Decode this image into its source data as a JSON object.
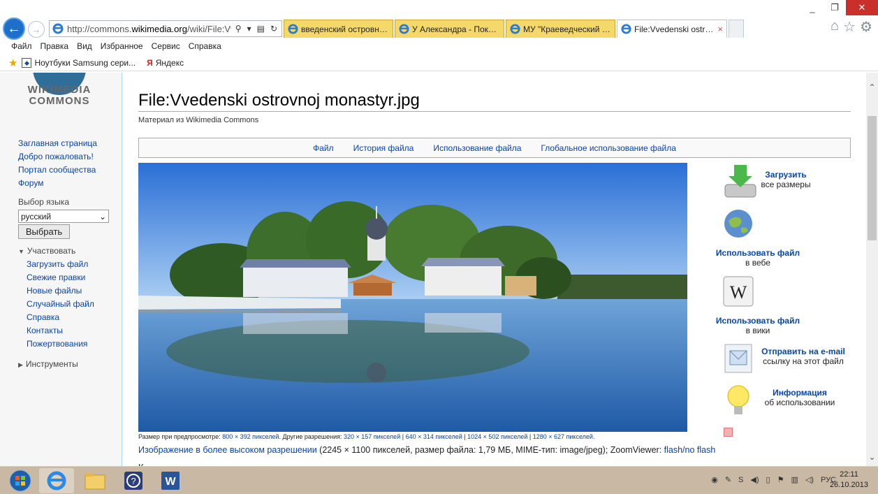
{
  "browser": {
    "url_prefix": "http://commons.",
    "url_domain": "wikimedia.org",
    "url_path": "/wiki/File:Vv",
    "tabs": [
      {
        "label": "введенский островно...",
        "active": false
      },
      {
        "label": "У Александра - Покро...",
        "active": false
      },
      {
        "label": "МУ \"Краеведческий м...",
        "active": false
      },
      {
        "label": "File:Vvedenski ostro...",
        "active": true
      }
    ],
    "tab_close": "×",
    "menu": [
      "Файл",
      "Правка",
      "Вид",
      "Избранное",
      "Сервис",
      "Справка"
    ],
    "favorites": [
      {
        "label": "Ноутбуки Samsung сери...",
        "icon": "samsung-icon"
      },
      {
        "label": "Яндекс",
        "icon": "yandex-icon"
      }
    ],
    "controls": {
      "minimize": "_",
      "maximize": "❐",
      "close": "✕"
    }
  },
  "sidebar": {
    "logo_line1": "WIKIMEDIA",
    "logo_line2": "COMMONS",
    "nav": [
      "Заглавная страница",
      "Добро пожаловать!",
      "Портал сообщества",
      "Форум"
    ],
    "language_label": "Выбор языка",
    "language_value": "русский",
    "language_button": "Выбрать",
    "participate_title": "Участвовать",
    "participate_items": [
      "Загрузить файл",
      "Свежие правки",
      "Новые файлы",
      "Случайный файл",
      "Справка",
      "Контакты",
      "Пожертвования"
    ],
    "tools_title": "Инструменты"
  },
  "content": {
    "title": "File:Vvedenski ostrovnoj monastyr.jpg",
    "subtitle": "Материал из Wikimedia Commons",
    "file_tabs": [
      "Файл",
      "История файла",
      "Использование файла",
      "Глобальное использование файла"
    ],
    "caption_prefix": "Размер при предпросмотре: ",
    "caption_preview": "800 × 392 пикселей",
    "caption_mid": ". Другие разрешения: ",
    "caption_res": [
      "320 × 157 пикселей",
      "640 × 314 пикселей",
      "1024 × 502 пикселей",
      "1280 × 627 пикселей"
    ],
    "caption_sep": " | ",
    "caption_end": ".",
    "hires_link": "Изображение в более высоком разрешении",
    "hires_info": " (2245 × 1100 пикселей, размер файла: 1,79 МБ, MIME-тип: image/jpeg); ZoomViewer: ",
    "hires_zoom": "flash/no flash",
    "more_heading": "К"
  },
  "actions": [
    {
      "link": "Загрузить",
      "sub": "все размеры",
      "icon": "download-icon"
    },
    {
      "link": "Использовать файл",
      "sub": "в вебе",
      "icon": "globe-icon"
    },
    {
      "link": "Использовать файл",
      "sub": "в вики",
      "icon": "wikipedia-icon"
    },
    {
      "link": "Отправить на e-mail",
      "sub": "ссылку на этот файл",
      "icon": "email-icon"
    },
    {
      "link": "Информация",
      "sub": "об использовании",
      "icon": "lightbulb-icon"
    }
  ],
  "taskbar": {
    "apps": [
      "start-orb-icon",
      "internet-explorer-icon",
      "file-explorer-icon",
      "help-icon",
      "word-icon"
    ],
    "lang": "РУС",
    "time": "22:11",
    "date": "26.10.2013"
  }
}
